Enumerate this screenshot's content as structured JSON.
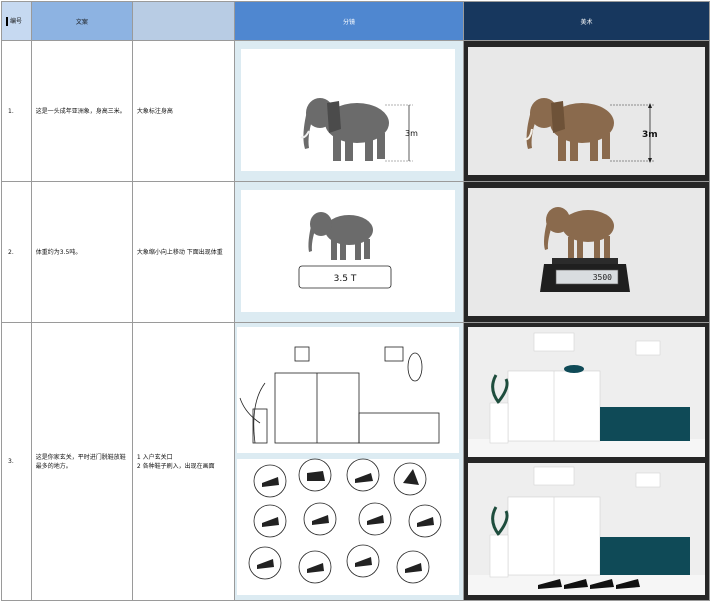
{
  "headers": {
    "num": "编号",
    "copy": "文案",
    "note": "",
    "storyboard": "分镜",
    "art": "美术"
  },
  "rows": [
    {
      "num": "1.",
      "copy": "这是一头成年亚洲象，身高三米。",
      "note": "大象标注身高",
      "story_label": "3m",
      "art_label": "3m"
    },
    {
      "num": "2.",
      "copy": "体重约为3.5吨。",
      "note": "大象缩小向上移动  下面出现体重",
      "story_label": "3.5 T",
      "art_label": "3500"
    },
    {
      "num": "3.",
      "copy": "这是你家玄关，平时进门脱鞋放鞋最多的地方。",
      "note_lines": [
        "1  入户玄关口",
        "2  各种鞋子刷入，出现在画面"
      ]
    }
  ],
  "colors": {
    "header_num": "#c6d9f1",
    "header_copy": "#8db3e2",
    "header_storyboard": "#4f87d0",
    "header_art": "#17375e",
    "teal_bench": "#0f4a57"
  }
}
